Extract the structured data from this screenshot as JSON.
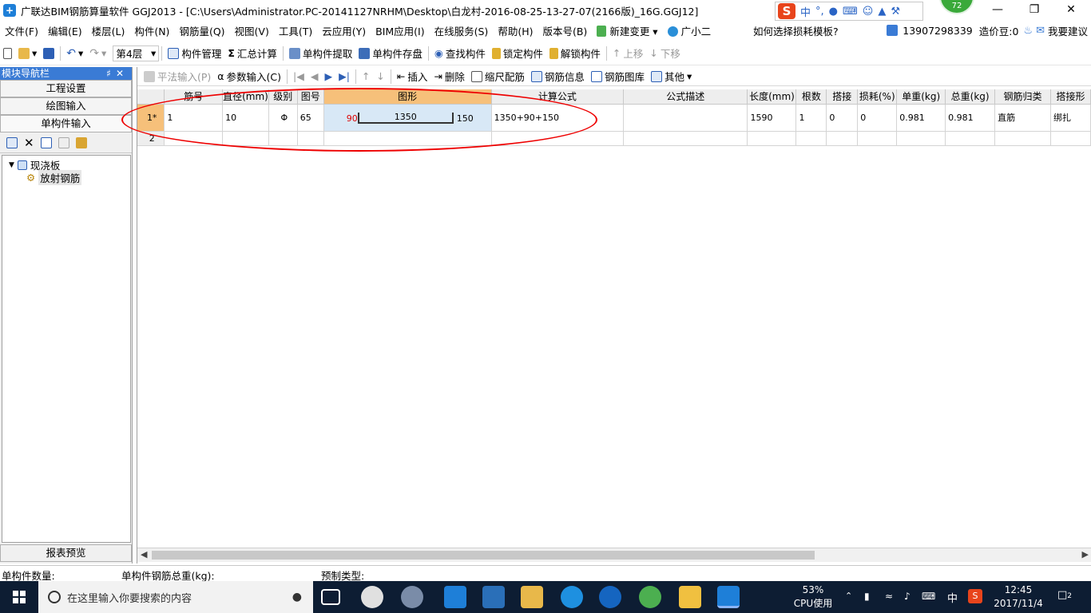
{
  "window": {
    "title": "广联达BIM钢筋算量软件 GGJ2013 - [C:\\Users\\Administrator.PC-20141127NRHM\\Desktop\\白龙村-2016-08-25-13-27-07(2166版)_16G.GGJ12]",
    "ime_label": "中",
    "badge": "72"
  },
  "menu": {
    "items": [
      "文件(F)",
      "编辑(E)",
      "楼层(L)",
      "构件(N)",
      "钢筋量(Q)",
      "视图(V)",
      "工具(T)",
      "云应用(Y)",
      "BIM应用(I)",
      "在线服务(S)",
      "帮助(H)",
      "版本号(B)",
      "新建变更",
      "广小二"
    ],
    "loss_template_link": "如何选择损耗模板?",
    "phone": "13907298339",
    "beans": "造价豆:0",
    "suggest": "我要建议"
  },
  "toolbar": {
    "floor": "第4层",
    "items": [
      "构件管理",
      "汇总计算",
      "单构件提取",
      "单构件存盘",
      "查找构件",
      "锁定构件",
      "解锁构件",
      "上移",
      "下移"
    ]
  },
  "nav": {
    "title": "模块导航栏",
    "sections": [
      "工程设置",
      "绘图输入",
      "单构件输入"
    ],
    "tree_root": "现浇板",
    "tree_child": "放射钢筋",
    "footer": "报表预览"
  },
  "grid_toolbar": {
    "items": [
      "平法输入(P)",
      "参数输入(C)",
      "插入",
      "删除",
      "缩尺配筋",
      "钢筋信息",
      "钢筋图库",
      "其他"
    ]
  },
  "grid": {
    "headers": [
      "",
      "筋号",
      "直径(mm)",
      "级别",
      "图号",
      "图形",
      "计算公式",
      "公式描述",
      "长度(mm)",
      "根数",
      "搭接",
      "损耗(%)",
      "单重(kg)",
      "总重(kg)",
      "钢筋归类",
      "搭接形"
    ],
    "row1": {
      "no": "1*",
      "bar_no": "1",
      "diameter": "10",
      "grade": "Φ",
      "fig_no": "65",
      "shape_left": "90",
      "shape_mid": "1350",
      "shape_right": "150",
      "formula": "1350+90+150",
      "desc": "",
      "length": "1590",
      "count": "1",
      "lap": "0",
      "loss": "0",
      "unit_weight": "0.981",
      "total_weight": "0.981",
      "category": "直筋",
      "lap_type": "绑扎"
    },
    "row2_no": "2"
  },
  "status": {
    "count_label": "单构件数量:",
    "weight_label": "单构件钢筋总重(kg):",
    "prefab_label": "预制类型:"
  },
  "taskbar": {
    "search_placeholder": "在这里输入你要搜索的内容",
    "cpu_percent": "53%",
    "cpu_label": "CPU使用",
    "ime": "中",
    "time": "12:45",
    "date": "2017/11/4",
    "notif": "2"
  },
  "colors": {
    "accent": "#3a7bd5",
    "row_header": "#f6c07a",
    "shape_cell": "#d8e8f6",
    "annotation": "#e00000",
    "taskbar": "#0d1d33"
  }
}
